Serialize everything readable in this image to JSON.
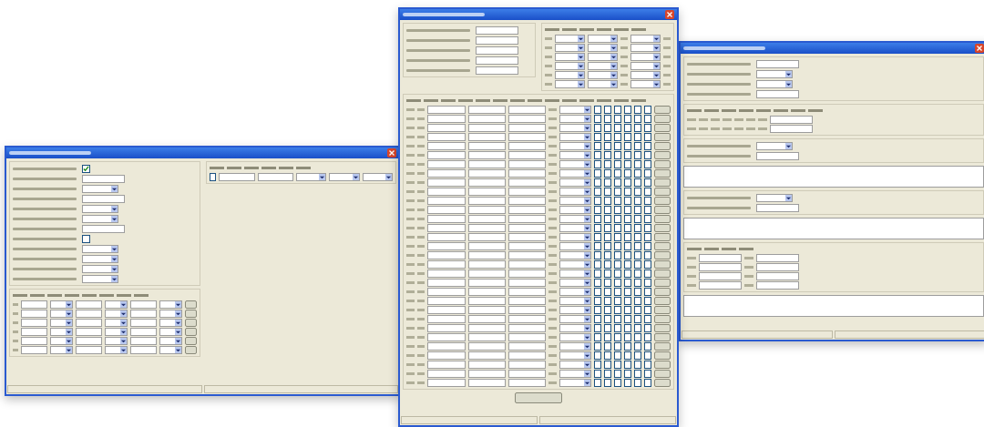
{
  "windows": [
    {
      "blocks": [
        {
          "kind": "split",
          "parts": [
            [
              {
                "kind": "form",
                "rows": [
                  {
                    "kind": "checkbox",
                    "checked": true
                  },
                  {
                    "kind": "field"
                  },
                  {
                    "kind": "dropdown"
                  },
                  {
                    "kind": "field"
                  },
                  {
                    "kind": "dropdown"
                  },
                  {
                    "kind": "dropdown"
                  },
                  {
                    "kind": "field"
                  },
                  {
                    "kind": "checkbox",
                    "checked": false
                  },
                  {
                    "kind": "dropdown"
                  },
                  {
                    "kind": "dropdown"
                  },
                  {
                    "kind": "dropdown"
                  },
                  {
                    "kind": "dropdown"
                  }
                ]
              },
              {
                "kind": "grid",
                "columns": [
                  {
                    "kind": "num"
                  },
                  {
                    "kind": "field"
                  },
                  {
                    "kind": "dropdown"
                  },
                  {
                    "kind": "field"
                  },
                  {
                    "kind": "dropdown"
                  },
                  {
                    "kind": "field"
                  },
                  {
                    "kind": "dropdown"
                  },
                  {
                    "kind": "button"
                  }
                ],
                "rows": [
                  {
                    "selected": false
                  },
                  {
                    "selected": false
                  },
                  {
                    "selected": false
                  },
                  {
                    "selected": false
                  },
                  {
                    "selected": false
                  },
                  {
                    "selected": false
                  }
                ]
              }
            ],
            [
              {
                "kind": "grid",
                "columns": [
                  {
                    "kind": "check"
                  },
                  {
                    "kind": "field"
                  },
                  {
                    "kind": "field"
                  },
                  {
                    "kind": "dropdown"
                  },
                  {
                    "kind": "dropdown"
                  },
                  {
                    "kind": "dropdown"
                  }
                ],
                "rows": [
                  {
                    "selected": false
                  }
                ]
              }
            ]
          ]
        }
      ]
    },
    {
      "blocks": [
        {
          "kind": "split",
          "parts": [
            [
              {
                "kind": "form",
                "rows": [
                  {
                    "kind": "field"
                  },
                  {
                    "kind": "field"
                  },
                  {
                    "kind": "field"
                  },
                  {
                    "kind": "field"
                  },
                  {
                    "kind": "field"
                  }
                ]
              }
            ],
            [
              {
                "kind": "grid",
                "columns": [
                  {
                    "kind": "num"
                  },
                  {
                    "kind": "dropdown"
                  },
                  {
                    "kind": "dropdown"
                  },
                  {
                    "kind": "num"
                  },
                  {
                    "kind": "dropdown"
                  },
                  {
                    "kind": "num"
                  }
                ],
                "rows": [
                  {
                    "selected": false
                  },
                  {
                    "selected": false
                  },
                  {
                    "selected": false
                  },
                  {
                    "selected": false
                  },
                  {
                    "selected": false
                  },
                  {
                    "selected": false
                  }
                ]
              }
            ]
          ]
        },
        {
          "kind": "grid",
          "columns": [
            {
              "kind": "num"
            },
            {
              "kind": "num"
            },
            {
              "kind": "field"
            },
            {
              "kind": "field"
            },
            {
              "kind": "field"
            },
            {
              "kind": "num"
            },
            {
              "kind": "dropdown"
            },
            {
              "kind": "check"
            },
            {
              "kind": "check"
            },
            {
              "kind": "check"
            },
            {
              "kind": "check"
            },
            {
              "kind": "check"
            },
            {
              "kind": "check"
            },
            {
              "kind": "button"
            }
          ],
          "rows": [
            {
              "selected": false
            },
            {
              "selected": false
            },
            {
              "selected": false
            },
            {
              "selected": false
            },
            {
              "selected": false
            },
            {
              "selected": false
            },
            {
              "selected": false
            },
            {
              "selected": false
            },
            {
              "selected": false
            },
            {
              "selected": false
            },
            {
              "selected": false
            },
            {
              "selected": false
            },
            {
              "selected": false
            },
            {
              "selected": false
            },
            {
              "selected": false
            },
            {
              "selected": false
            },
            {
              "selected": false
            },
            {
              "selected": false
            },
            {
              "selected": false
            },
            {
              "selected": false
            },
            {
              "selected": false
            },
            {
              "selected": false
            },
            {
              "selected": false
            },
            {
              "selected": false
            },
            {
              "selected": false
            },
            {
              "selected": false
            },
            {
              "selected": false
            },
            {
              "selected": false
            },
            {
              "selected": false
            },
            {
              "selected": false
            },
            {
              "selected": false
            }
          ]
        },
        {
          "kind": "button"
        }
      ]
    },
    {
      "blocks": [
        {
          "kind": "form",
          "rows": [
            {
              "kind": "field"
            },
            {
              "kind": "dropdown"
            },
            {
              "kind": "dropdown"
            },
            {
              "kind": "field"
            }
          ]
        },
        {
          "kind": "grid",
          "columns": [
            {
              "kind": "num"
            },
            {
              "kind": "num"
            },
            {
              "kind": "num"
            },
            {
              "kind": "num"
            },
            {
              "kind": "num"
            },
            {
              "kind": "num"
            },
            {
              "kind": "num"
            },
            {
              "kind": "field"
            }
          ],
          "rows": [
            {
              "selected": false
            },
            {
              "selected": false
            }
          ]
        },
        {
          "kind": "form",
          "rows": [
            {
              "kind": "dropdown"
            },
            {
              "kind": "field"
            }
          ]
        },
        {
          "kind": "textarea"
        },
        {
          "kind": "form",
          "rows": [
            {
              "kind": "dropdown"
            },
            {
              "kind": "field"
            }
          ]
        },
        {
          "kind": "textarea"
        },
        {
          "kind": "grid",
          "columns": [
            {
              "kind": "num"
            },
            {
              "kind": "field"
            },
            {
              "kind": "num"
            },
            {
              "kind": "field"
            }
          ],
          "rows": [
            {
              "selected": false
            },
            {
              "selected": false
            },
            {
              "selected": false
            },
            {
              "selected": false
            }
          ]
        },
        {
          "kind": "textarea"
        }
      ]
    }
  ]
}
